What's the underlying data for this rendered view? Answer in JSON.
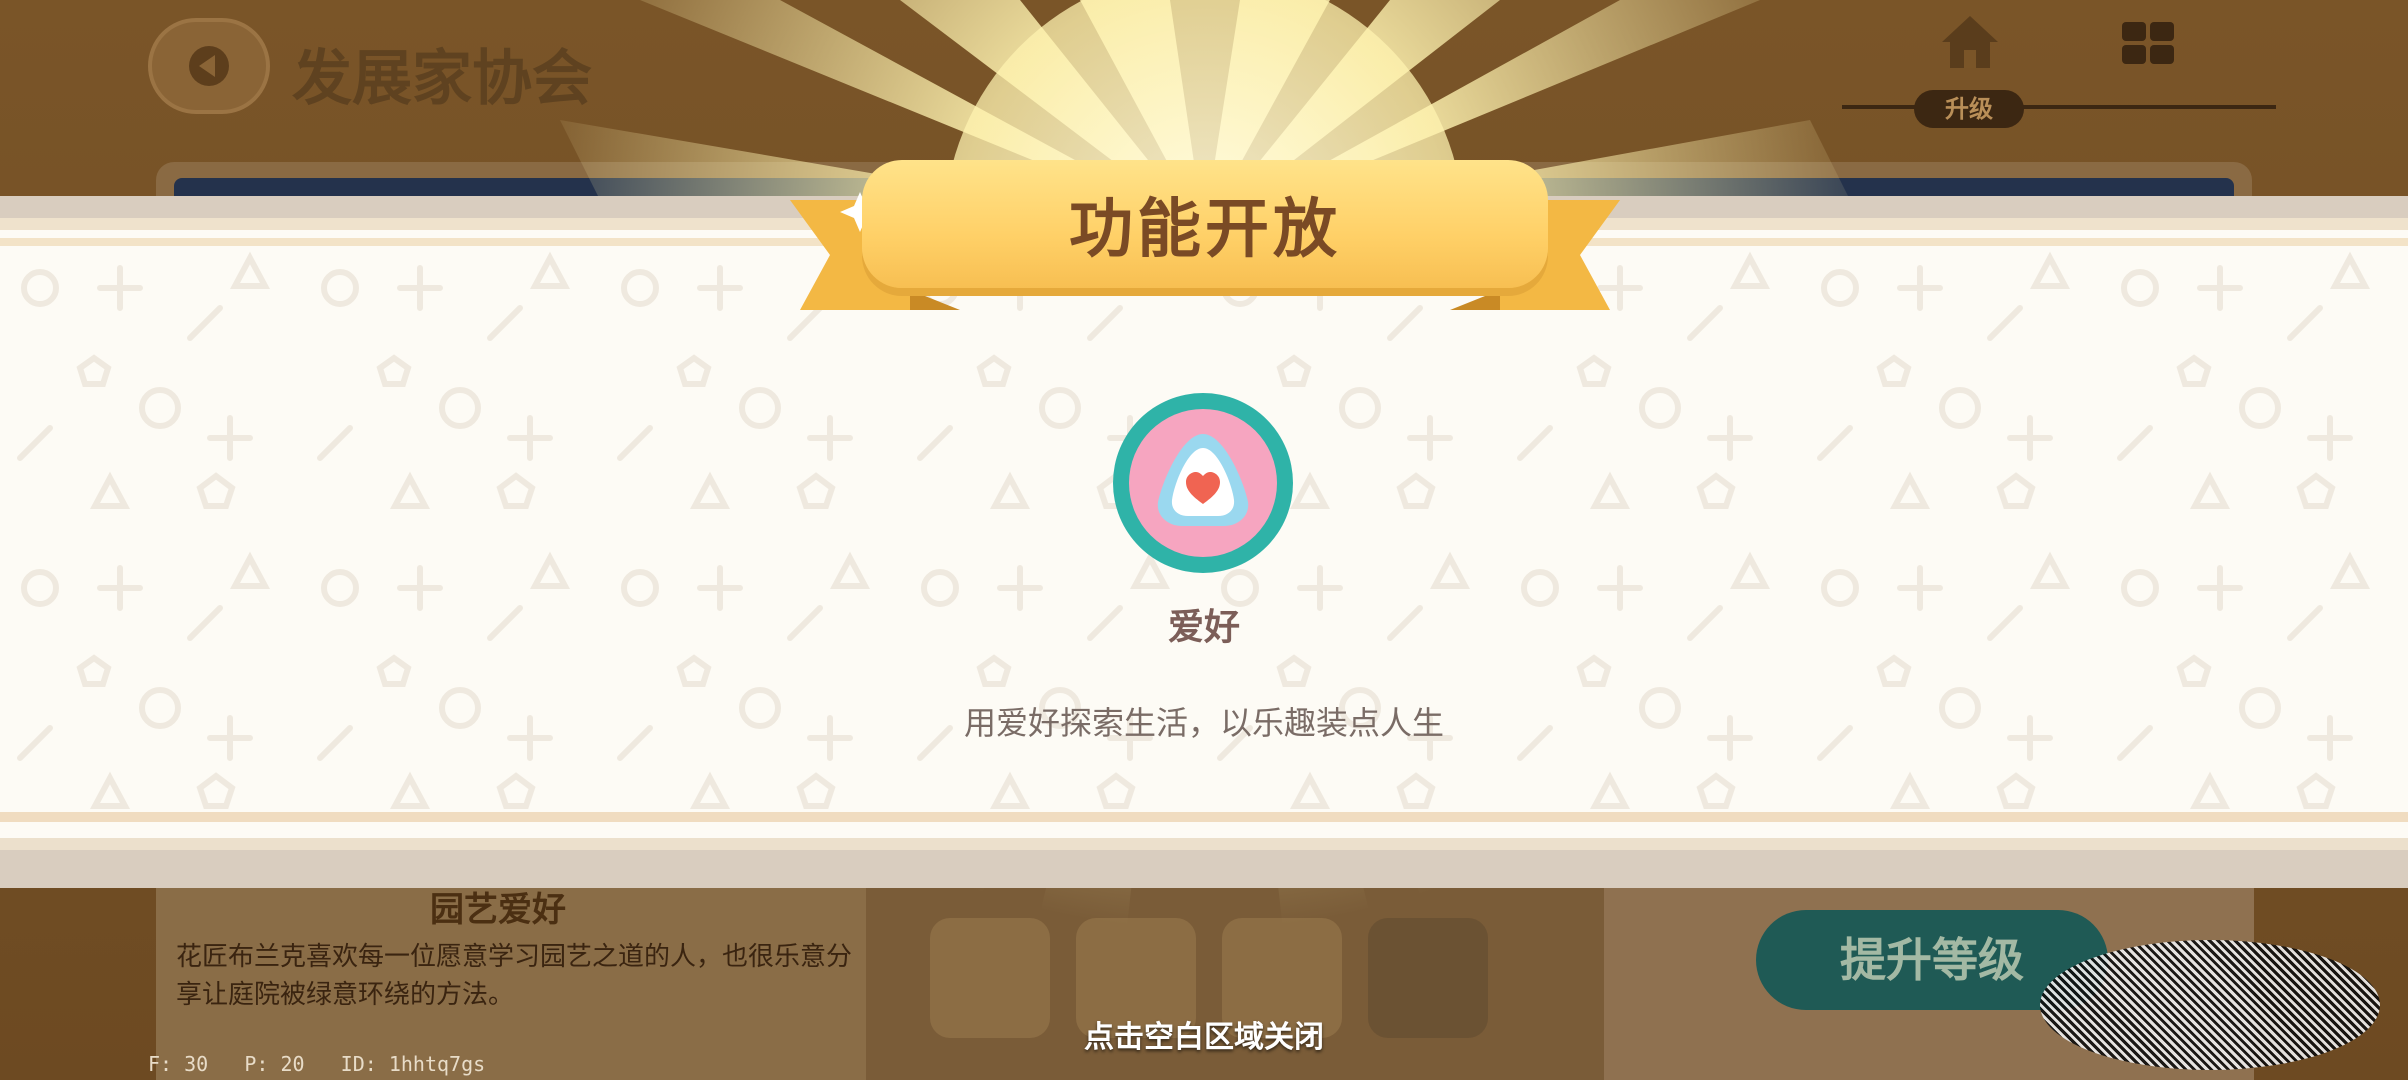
{
  "background": {
    "title": "发展家协会",
    "tab_label": "升级",
    "section_title": "园艺爱好",
    "section_desc": "花匠布兰克喜欢每一位愿意学习园艺之道的人，也很乐意分享让庭院被绿意环绕的方法。",
    "upgrade_button": "提升等级",
    "debug_info": "F: 30   P: 20   ID: 1hhtq7gs"
  },
  "modal": {
    "ribbon_title": "功能开放",
    "feature_name": "爱好",
    "feature_icon": "heart-badge-icon",
    "feature_desc": "用爱好探索生活，以乐趣装点人生",
    "close_hint": "点击空白区域关闭"
  },
  "colors": {
    "ribbon": "#ffd067",
    "banner_bg": "#fdfbf5",
    "icon_ring": "#2fb3a8",
    "icon_inner": "#f6a5c0",
    "heart": "#f06452",
    "upgrade_button": "#1f5a55"
  }
}
